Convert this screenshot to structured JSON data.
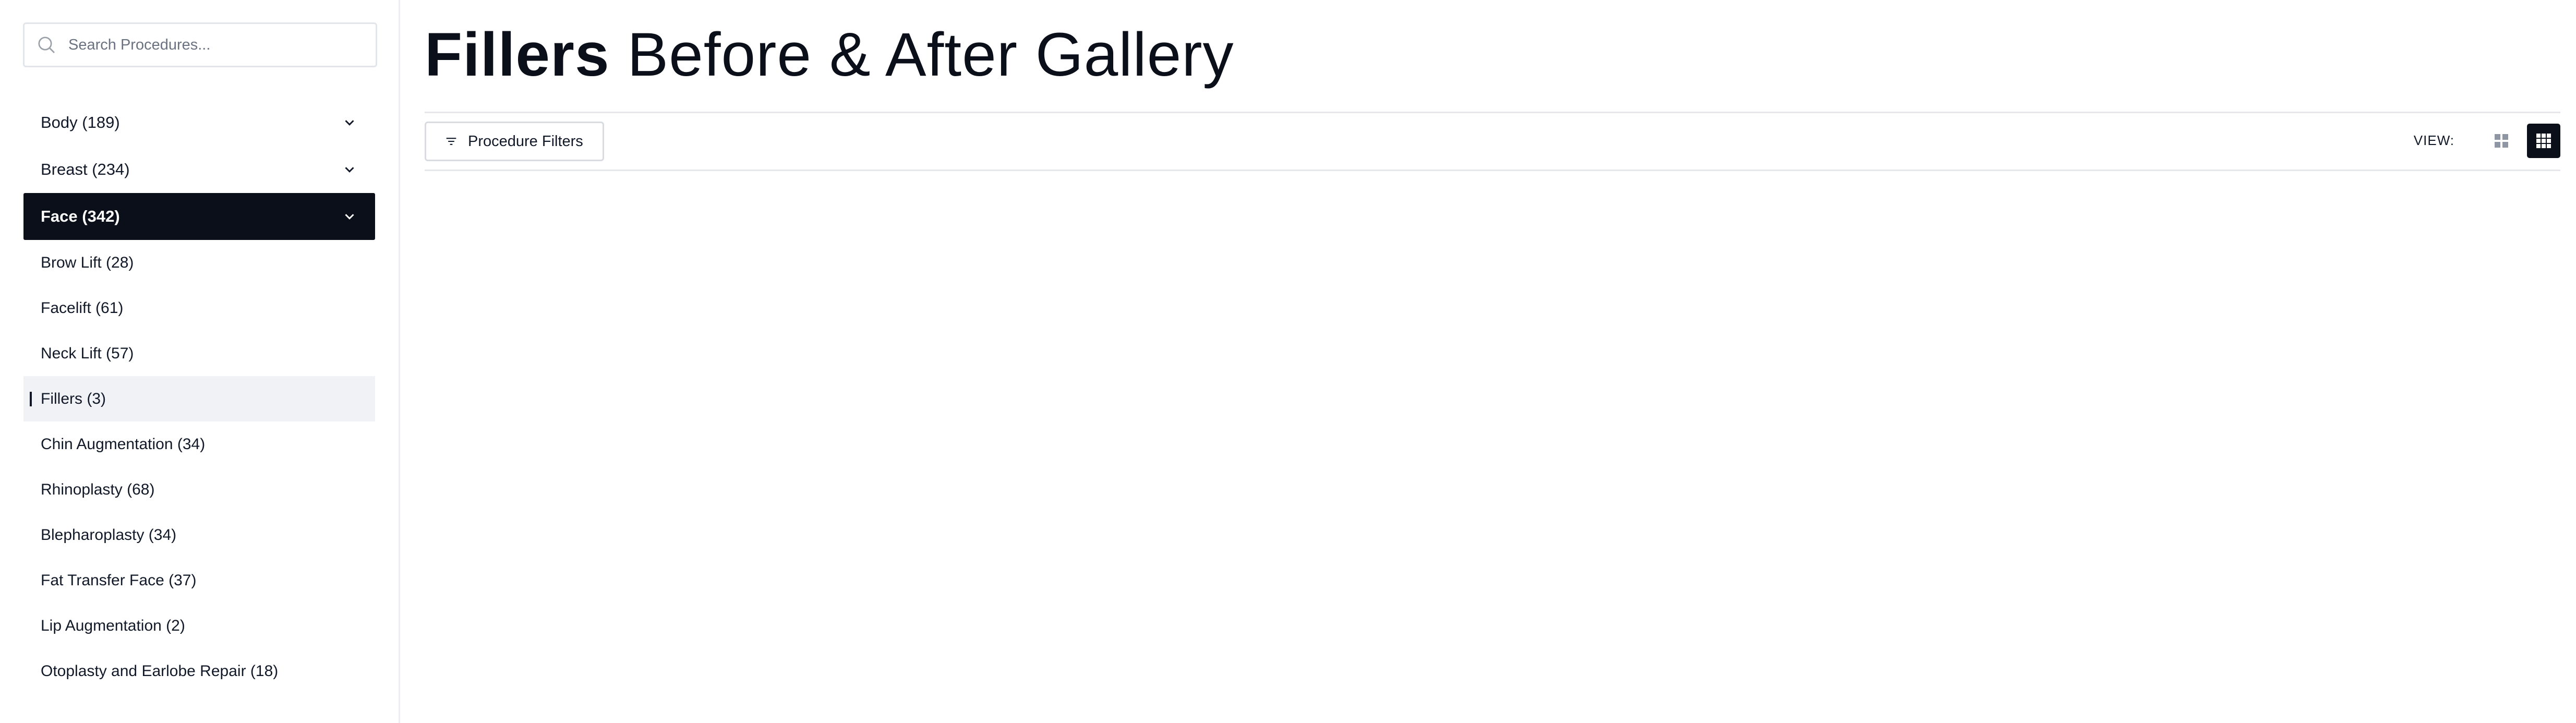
{
  "sidebar": {
    "search": {
      "placeholder": "Search Procedures..."
    },
    "categories": [
      {
        "label": "Body (189)"
      },
      {
        "label": "Breast (234)"
      },
      {
        "label": "Face (342)"
      }
    ],
    "face_items": [
      {
        "label": "Brow Lift (28)"
      },
      {
        "label": "Facelift (61)"
      },
      {
        "label": "Neck Lift (57)"
      },
      {
        "label": "Fillers (3)"
      },
      {
        "label": "Chin Augmentation (34)"
      },
      {
        "label": "Rhinoplasty (68)"
      },
      {
        "label": "Blepharoplasty (34)"
      },
      {
        "label": "Fat Transfer Face (37)"
      },
      {
        "label": "Lip Augmentation (2)"
      },
      {
        "label": "Otoplasty and Earlobe Repair (18)"
      }
    ]
  },
  "main": {
    "title_bold": "Fillers",
    "title_rest": " Before & After Gallery",
    "filter_label": "Procedure Filters",
    "view_label": "VIEW:"
  },
  "colors": {
    "active_bg": "#0b0f19",
    "selected_bg": "#f1f2f5",
    "border": "#e2e5ea"
  },
  "icons": {
    "search": "search-icon",
    "chevron": "chevron-down-icon",
    "filter": "filter-icon",
    "grid_large": "grid-large-icon",
    "grid_small": "grid-small-icon"
  }
}
